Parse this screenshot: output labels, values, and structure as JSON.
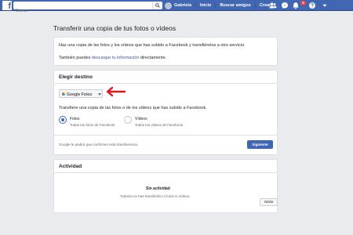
{
  "topbar": {
    "logo": "f",
    "search_placeholder": "Busca",
    "user_name": "Gabriela",
    "nav": [
      "Inicio",
      "Buscar amigos",
      "Crear"
    ],
    "notification_count": "5",
    "icons": [
      "friend-requests-icon",
      "messenger-icon",
      "notifications-icon",
      "help-icon",
      "account-menu-icon"
    ]
  },
  "page": {
    "title": "Transferir una copia de tus fotos o vídeos"
  },
  "intro": {
    "line1": "Haz una copia de las fotos y los vídeos que has subido a Facebook y transfiérelos a otro servicio.",
    "line2_prefix": "También puedes ",
    "line2_link": "descargar tu información",
    "line2_suffix": " directamente."
  },
  "destination": {
    "header": "Elegir destino",
    "dropdown_label": "Google Fotos",
    "description": "Transfiere una copia de las fotos o de los vídeos que has subido a Facebook.",
    "options": [
      {
        "title": "Fotos",
        "subtitle": "Todas tus fotos de Facebook",
        "checked": true
      },
      {
        "title": "Vídeos",
        "subtitle": "Todos tus vídeos de Facebook",
        "checked": false
      }
    ],
    "footnote": "Google te pedirá que confirmes esta transferencia.",
    "next_button": "Siguiente"
  },
  "activity": {
    "header": "Actividad",
    "empty_title": "Sin actividad",
    "empty_subtitle": "Todavía no has transferido ni fotos ni vídeos."
  },
  "back_button": "Atrás",
  "colors": {
    "brand": "#4267b2",
    "annotation_arrow": "#e0141e"
  }
}
